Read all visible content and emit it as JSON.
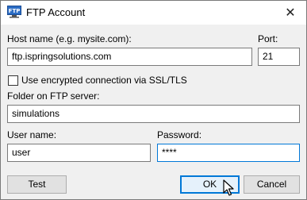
{
  "window": {
    "title": "FTP Account",
    "app_icon_text": "FTP",
    "close_glyph": "✕"
  },
  "form": {
    "host_label": "Host name (e.g. mysite.com):",
    "host_value": "ftp.ispringsolutions.com",
    "port_label": "Port:",
    "port_value": "21",
    "ssl_label": "Use encrypted connection via SSL/TLS",
    "ssl_checked": false,
    "folder_label": "Folder on FTP server:",
    "folder_value": "simulations",
    "user_label": "User name:",
    "user_value": "user",
    "password_label": "Password:",
    "password_value": "****"
  },
  "buttons": {
    "test": "Test",
    "ok": "OK",
    "cancel": "Cancel"
  },
  "icons": {
    "app": "ftp-icon",
    "close": "close-icon",
    "cursor": "mouse-pointer-icon"
  }
}
